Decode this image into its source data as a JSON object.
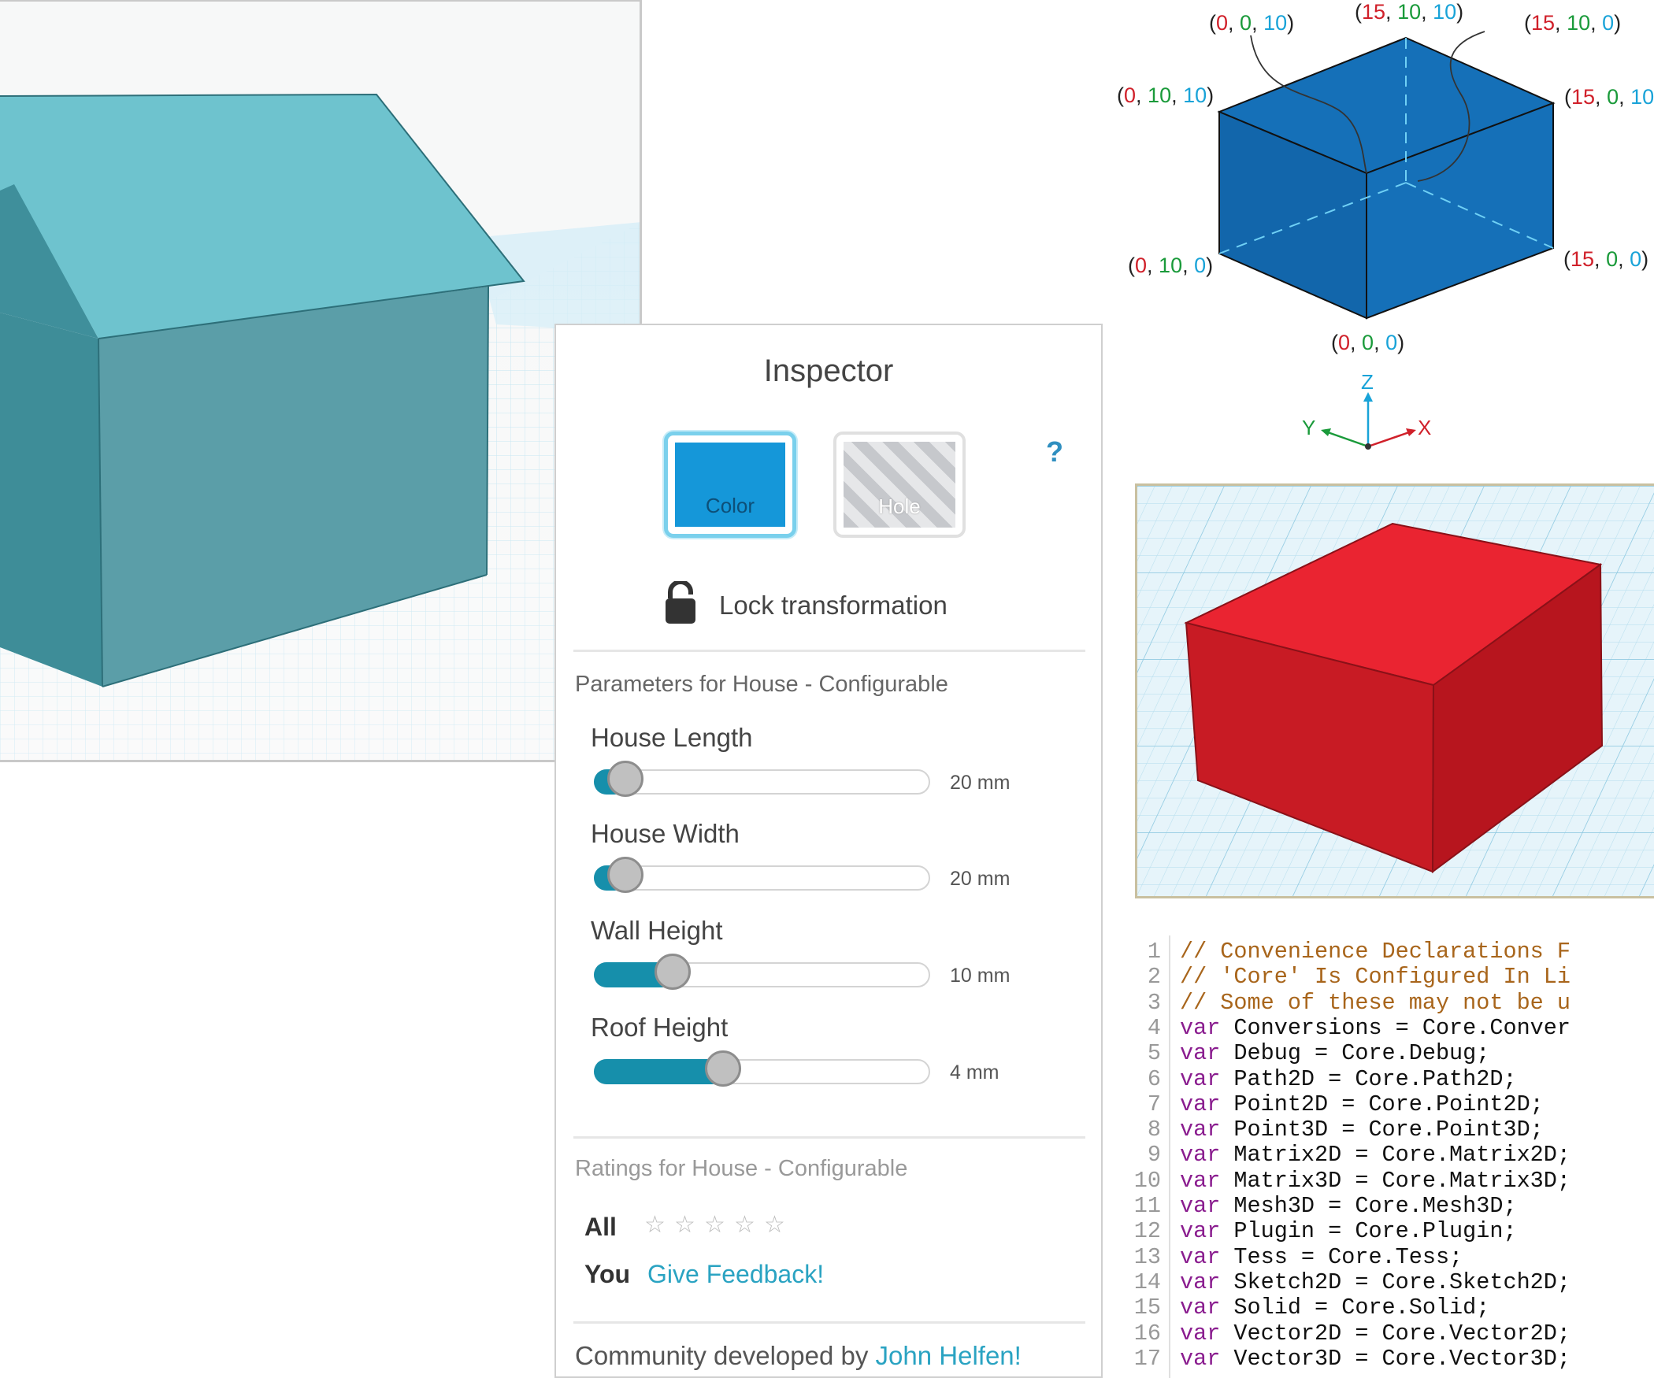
{
  "inspector": {
    "title": "Inspector",
    "color_label": "Color",
    "hole_label": "Hole",
    "help": "?",
    "lock_label": "Lock transformation",
    "params_title": "Parameters for House - Configurable",
    "params": [
      {
        "label": "House Length",
        "value": "20 mm",
        "fill_fraction": 0.09
      },
      {
        "label": "House Width",
        "value": "20 mm",
        "fill_fraction": 0.09
      },
      {
        "label": "Wall Height",
        "value": "10 mm",
        "fill_fraction": 0.23
      },
      {
        "label": "Roof Height",
        "value": "4 mm",
        "fill_fraction": 0.38
      }
    ],
    "ratings_title": "Ratings for House - Configurable",
    "rating_all_label": "All",
    "rating_you_label": "You",
    "rating_stars": 5,
    "feedback_link": "Give Feedback!",
    "credit_prefix": "Community developed by",
    "credit_author": "John Helfen!"
  },
  "coordinates": {
    "top_back": [
      "15",
      "10",
      "10"
    ],
    "top_left": [
      "0",
      "0",
      "10"
    ],
    "top_right": [
      "15",
      "10",
      "0"
    ],
    "left_top": [
      "0",
      "10",
      "10"
    ],
    "right_top": [
      "15",
      "0",
      "10"
    ],
    "left_bottom": [
      "0",
      "10",
      "0"
    ],
    "right_bottom": [
      "15",
      "0",
      "0"
    ],
    "bottom_front": [
      "0",
      "0",
      "0"
    ]
  },
  "axes": {
    "z": "Z",
    "y": "Y",
    "x": "X"
  },
  "colors": {
    "house": "#5fb9c8",
    "cube_blue": "#1570b8",
    "red_box": "#d41f2a",
    "accent": "#2aa3c2",
    "x_axis": "#d0202a",
    "y_axis": "#1a9a3a",
    "z_axis": "#19a3d8"
  },
  "code_lines": [
    {
      "n": "1",
      "kind": "comment",
      "text": "// Convenience Declarations F"
    },
    {
      "n": "2",
      "kind": "comment",
      "text": "// 'Core' Is Configured In Li"
    },
    {
      "n": "3",
      "kind": "comment",
      "text": "// Some of these may not be u"
    },
    {
      "n": "4",
      "kind": "var",
      "text": " Conversions = Core.Conver"
    },
    {
      "n": "5",
      "kind": "var",
      "text": " Debug = Core.Debug;"
    },
    {
      "n": "6",
      "kind": "var",
      "text": " Path2D = Core.Path2D;"
    },
    {
      "n": "7",
      "kind": "var",
      "text": " Point2D = Core.Point2D;"
    },
    {
      "n": "8",
      "kind": "var",
      "text": " Point3D = Core.Point3D;"
    },
    {
      "n": "9",
      "kind": "var",
      "text": " Matrix2D = Core.Matrix2D;"
    },
    {
      "n": "10",
      "kind": "var",
      "text": " Matrix3D = Core.Matrix3D;"
    },
    {
      "n": "11",
      "kind": "var",
      "text": " Mesh3D = Core.Mesh3D;"
    },
    {
      "n": "12",
      "kind": "var",
      "text": " Plugin = Core.Plugin;"
    },
    {
      "n": "13",
      "kind": "var",
      "text": " Tess = Core.Tess;"
    },
    {
      "n": "14",
      "kind": "var",
      "text": " Sketch2D = Core.Sketch2D;"
    },
    {
      "n": "15",
      "kind": "var",
      "text": " Solid = Core.Solid;"
    },
    {
      "n": "16",
      "kind": "var",
      "text": " Vector2D = Core.Vector2D;"
    },
    {
      "n": "17",
      "kind": "var",
      "text": " Vector3D = Core.Vector3D;"
    }
  ],
  "keyword": "var",
  "icons": [
    "lock-icon",
    "star-icon",
    "help-icon"
  ]
}
